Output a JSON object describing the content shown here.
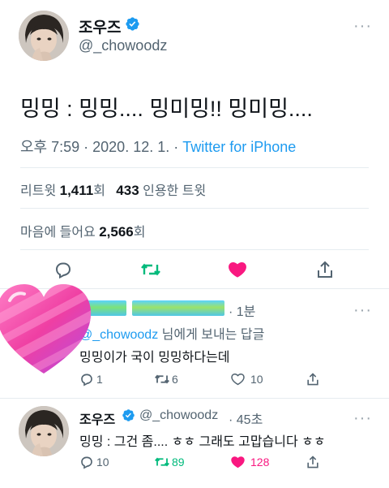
{
  "tweet": {
    "author_name": "조우즈",
    "author_handle": "@_chowoodz",
    "text": "밍밍 : 밍밍.... 밍미밍!! 밍미밍....",
    "time_date": "오후 7:59 · 2020. 12. 1. · ",
    "source": "Twitter for iPhone",
    "retweets_label": "리트윗 ",
    "retweets_count": "1,411",
    "retweets_unit": "회",
    "quotes_count": "433",
    "quotes_label": " 인용한 트윗",
    "likes_label": "마음에 들어요 ",
    "likes_count": "2,566",
    "likes_unit": "회"
  },
  "reply1": {
    "time": "· 1분",
    "replying_mention": "@_chowoodz",
    "replying_suffix": " 님에게 보내는 답글",
    "text": "밍밍이가 국이 밍밍하다는데",
    "reply_count": "1",
    "retweet_count": "6",
    "like_count": "10"
  },
  "reply2": {
    "author_name": "조우즈",
    "author_handle": "@_chowoodz",
    "time": "· 45초",
    "text": "밍밍 : 그건 좀.... ㅎㅎ 그래도 고맙습니다 ㅎㅎ",
    "reply_count": "10",
    "retweet_count": "89",
    "like_count": "128"
  },
  "icons": {
    "more": "more-dots-icon",
    "verified": "verified-badge-icon",
    "reply": "reply-icon",
    "retweet": "retweet-icon",
    "like": "heart-icon",
    "share": "share-icon",
    "sticker": "heart-sticker"
  },
  "colors": {
    "link": "#1d9bf0",
    "retweet_active": "#00ba7c",
    "like_active": "#f91880",
    "secondary_text": "#536471"
  }
}
